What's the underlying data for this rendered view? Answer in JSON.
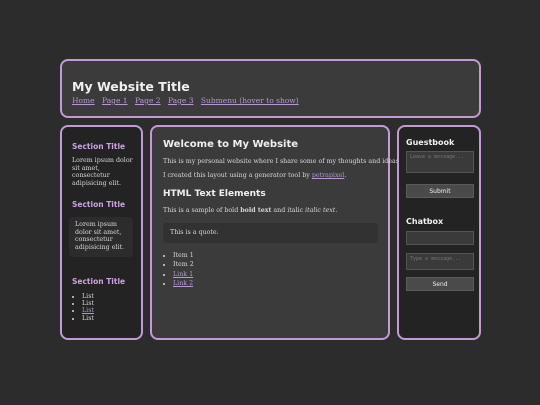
{
  "header": {
    "title": "My Website Title",
    "nav": [
      "Home",
      "Page 1",
      "Page 2",
      "Page 3",
      "Submenu (hover to show)"
    ]
  },
  "left_sidebar": {
    "section1_title": "Section Title",
    "section1_text": "Lorem ipsum dolor sit amet, consectetur adipisicing elit.",
    "section2_title": "Section Title",
    "section2_text": "Lorem ipsum dolor sit amet, consectetur adipisicing elit.",
    "section3_title": "Section Title",
    "list": [
      "List",
      "List",
      "List",
      "List"
    ]
  },
  "main": {
    "welcome": "Welcome to My Website",
    "intro": "This is my personal website where I share some of my thoughts and ideas.",
    "credit_before": "I created this layout using a generator tool by ",
    "credit_link": "petrapixel",
    "credit_after": ".",
    "html_heading": "HTML Text Elements",
    "sample_before": "This is a sample of bold ",
    "sample_bold": "bold text",
    "sample_mid": " and italic ",
    "sample_italic": "italic text",
    "sample_after": ".",
    "quote": "This is a quote.",
    "items": [
      "Item 1",
      "Item 2"
    ],
    "links": [
      "Link 1",
      "Link 2"
    ]
  },
  "right_sidebar": {
    "guestbook_title": "Guestbook",
    "guestbook_placeholder": "Leave a message...",
    "guestbook_submit": "Submit",
    "chatbox_title": "Chatbox",
    "chatbox_name_placeholder": "",
    "chatbox_message_placeholder": "Type a message...",
    "chatbox_send": "Send"
  }
}
